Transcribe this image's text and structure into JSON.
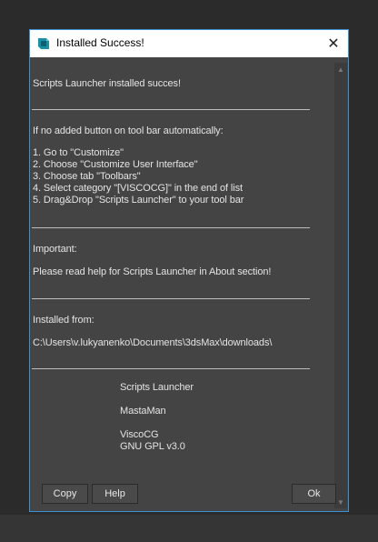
{
  "window": {
    "title": "Installed Success!",
    "close_glyph": "✕"
  },
  "content": {
    "line_installed": "Scripts Launcher installed succes!",
    "line_if_no_button": "If no added button on tool bar automatically:",
    "steps": [
      "1. Go to \"Customize\"",
      "2. Choose \"Customize User Interface\"",
      "3. Choose tab \"Toolbars\"",
      "4. Select category \"[VISCOCG]\" in the end of list",
      "5. Drag&Drop \"Scripts Launcher\" to your tool bar"
    ],
    "important_label": "Important:",
    "important_text": "Please read help for Scripts Launcher in About section!",
    "installed_from_label": "Installed from:",
    "installed_from_path": "C:\\Users\\v.lukyanenko\\Documents\\3dsMax\\downloads\\",
    "credits": {
      "product": "Scripts Launcher",
      "author": "MastaMan",
      "company": "ViscoCG",
      "license": "GNU GPL v3.0"
    }
  },
  "buttons": {
    "copy": "Copy",
    "help": "Help",
    "ok": "Ok"
  },
  "icons": {
    "app_icon": "3ds-max-icon",
    "close": "close-icon",
    "scroll_up": "scroll-up-arrow-icon",
    "scroll_down": "scroll-down-arrow-icon"
  },
  "colors": {
    "accent_border": "#3a8fd6",
    "window_bg": "#444444",
    "text": "#e4e4e4"
  }
}
